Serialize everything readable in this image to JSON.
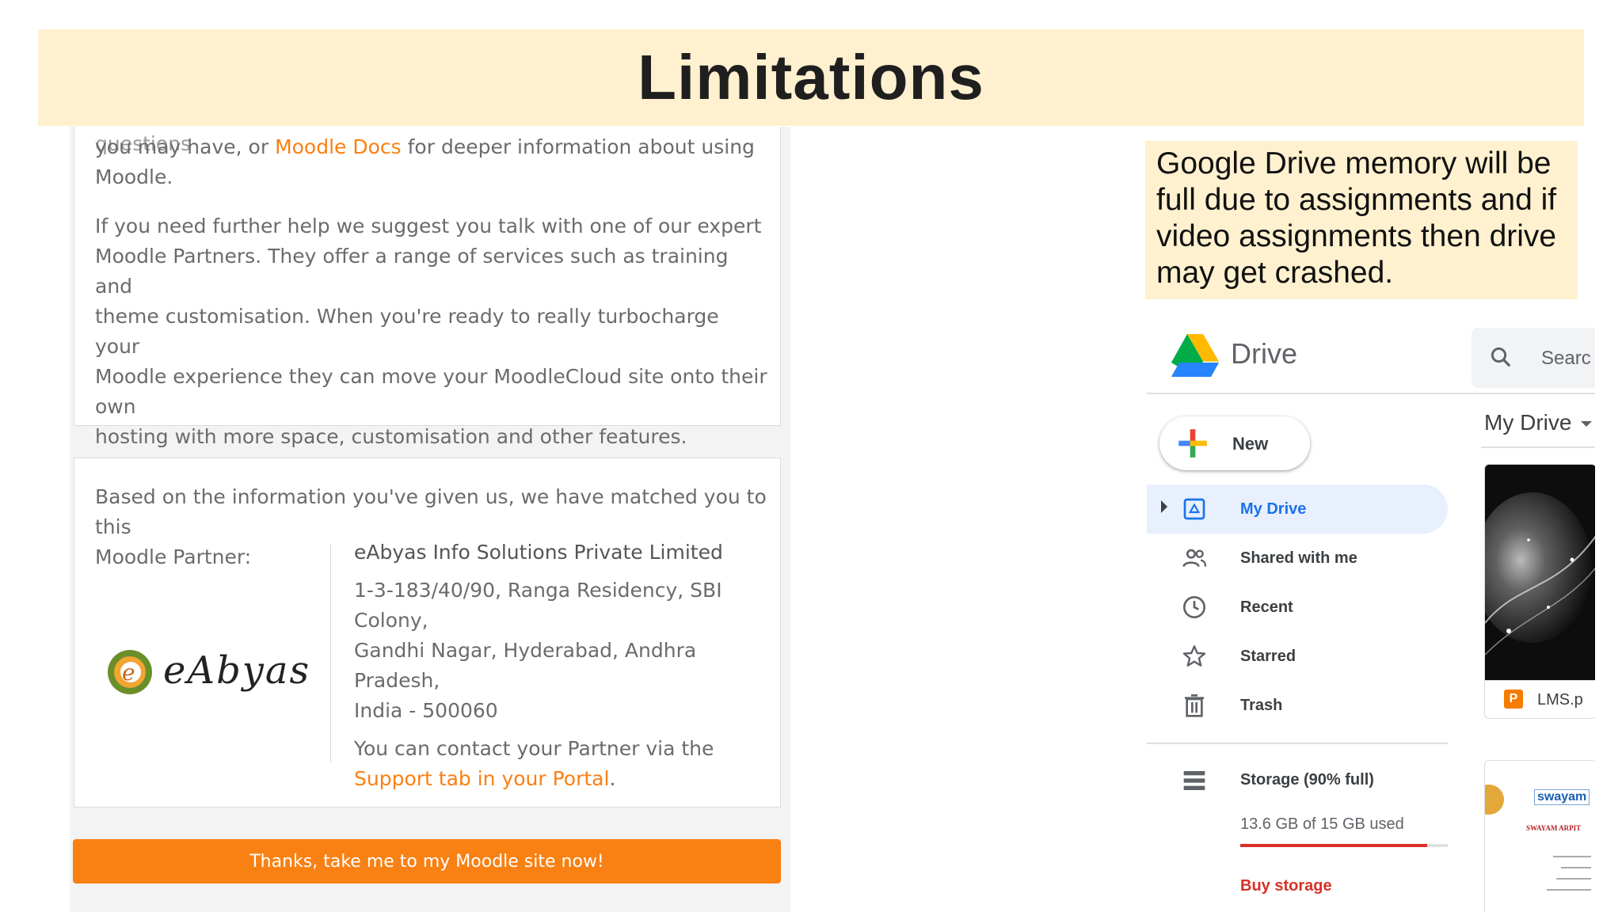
{
  "slide": {
    "title": "Limitations"
  },
  "moodle": {
    "cutoff_text": "support. See our FAQ for some answers to frequently asked questions",
    "help_para1": {
      "pre": "you may have, or ",
      "link": "Moodle Docs",
      "post": " for deeper information about using",
      "line3": "Moodle."
    },
    "help_para2_lines": [
      "If you need further help we suggest you talk with one of our expert",
      "Moodle Partners. They offer a range of services such as training and",
      "theme customisation. When you're ready to really turbocharge your",
      "Moodle experience they can move your MoodleCloud site onto their own",
      "hosting with more space, customisation and other features."
    ],
    "match_intro_lines": [
      "Based on the information you've given us, we have matched you to this",
      "Moodle Partner:"
    ],
    "partner": {
      "logo_text": "eAbyas",
      "name": "eAbyas Info Solutions Private Limited",
      "address_lines": [
        "1-3-183/40/90, Ranga Residency, SBI Colony,",
        "Gandhi Nagar, Hyderabad, Andhra Pradesh,",
        "India - 500060"
      ],
      "contact_lines": [
        "You can contact your Partner via the"
      ],
      "contact_link": "Support tab in your Portal",
      "contact_end": "."
    },
    "cta_label": "Thanks, take me to my Moodle site now!"
  },
  "callout": {
    "text": "Google Drive memory will be full due to assignments and if video assignments then drive may get crashed."
  },
  "drive": {
    "app_name": "Drive",
    "search_placeholder": "Searc",
    "new_label": "New",
    "my_drive_header": "My Drive",
    "nav": [
      {
        "label": "My Drive",
        "icon": "my-drive-icon",
        "active": true
      },
      {
        "label": "Shared with me",
        "icon": "shared-users-icon"
      },
      {
        "label": "Recent",
        "icon": "clock-icon"
      },
      {
        "label": "Starred",
        "icon": "star-icon"
      },
      {
        "label": "Trash",
        "icon": "trash-icon"
      }
    ],
    "storage_label": "Storage (90% full)",
    "storage_used_text": "13.6 GB of 15 GB used",
    "storage_fraction": 0.9,
    "buy_storage": "Buy storage",
    "file_name": "LMS.p",
    "thumb2_brand": "swayam",
    "thumb2_caption": "SWAYAM ARPIT",
    "colors": {
      "accent_blue": "#1a73e8",
      "storage_red": "#d93025",
      "active_bg": "#e8f0fe"
    }
  }
}
